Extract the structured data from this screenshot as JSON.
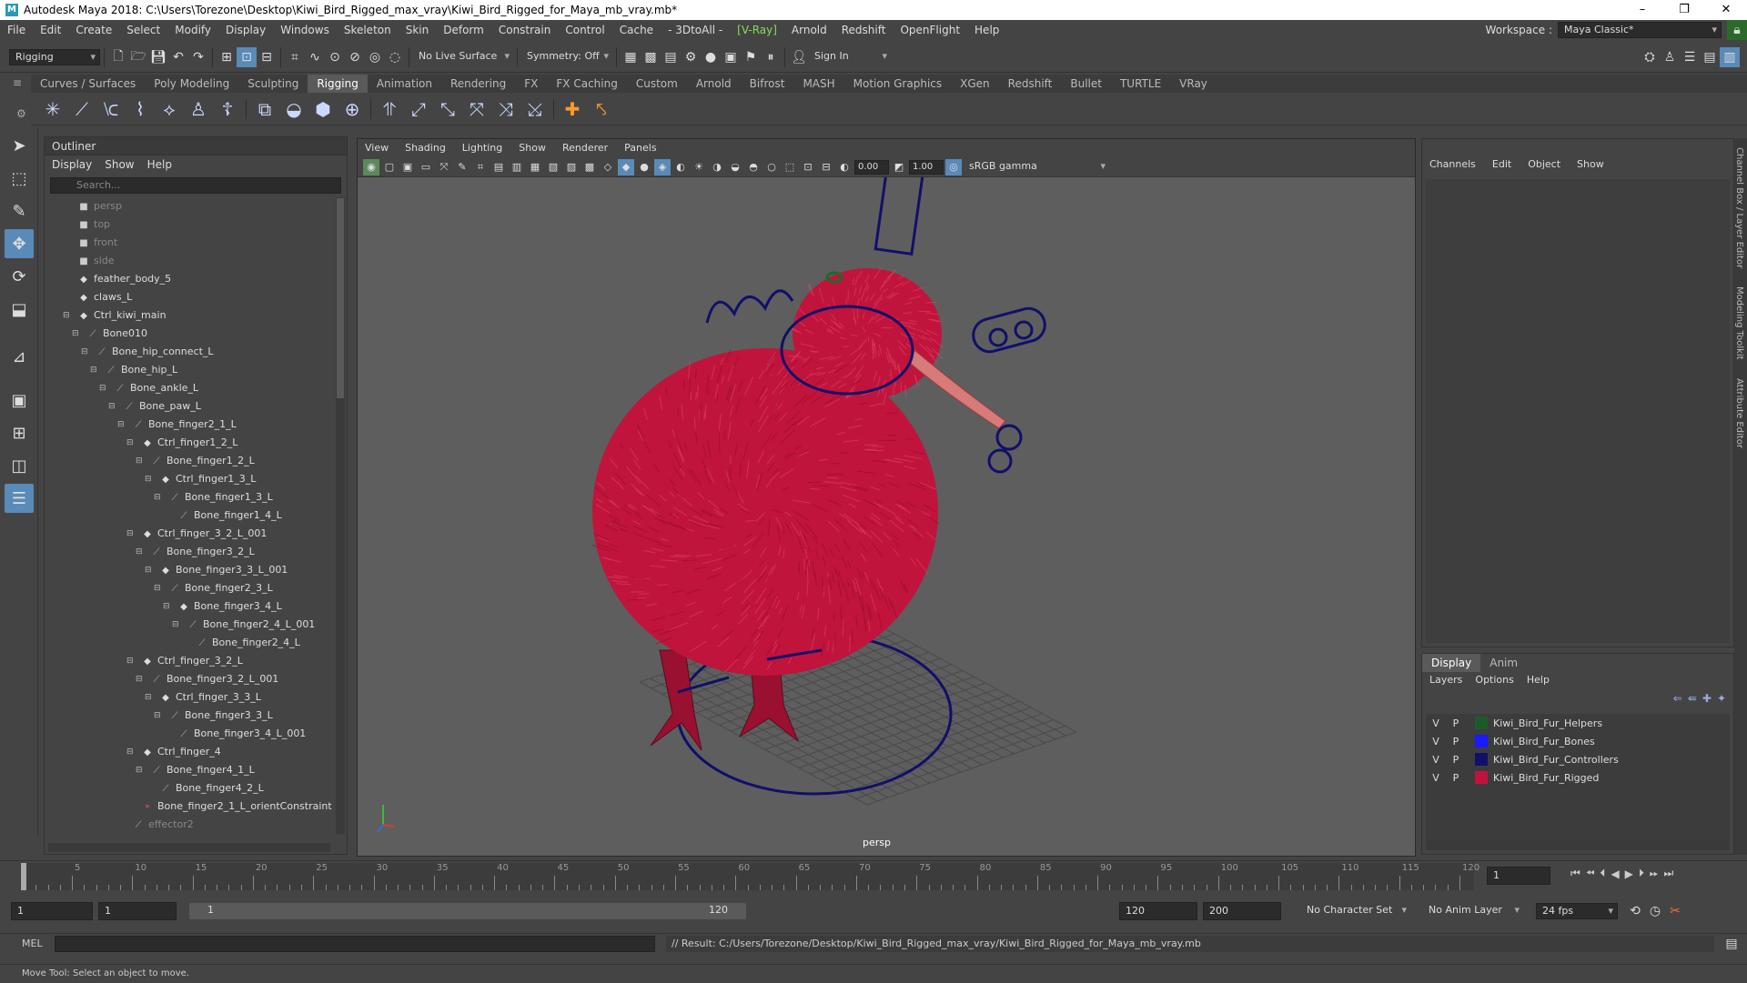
{
  "titlebar": {
    "title": "Autodesk Maya 2018: C:\\Users\\Torezone\\Desktop\\Kiwi_Bird_Rigged_max_vray\\Kiwi_Bird_Rigged_for_Maya_mb_vray.mb*",
    "logo": "M"
  },
  "menus": [
    "File",
    "Edit",
    "Create",
    "Select",
    "Modify",
    "Display",
    "Windows",
    "Skeleton",
    "Skin",
    "Deform",
    "Constrain",
    "Control",
    "Cache",
    "- 3DtoAll -",
    "[V-Ray]",
    "Arnold",
    "Redshift",
    "OpenFlight",
    "Help"
  ],
  "workspace": {
    "label": "Workspace :",
    "value": "Maya Classic*"
  },
  "statusline": {
    "mode": "Rigging",
    "live_surface": "No Live Surface",
    "symmetry": "Symmetry: Off",
    "signin": "Sign In"
  },
  "shelf_tabs": [
    "Curves / Surfaces",
    "Poly Modeling",
    "Sculpting",
    "Rigging",
    "Animation",
    "Rendering",
    "FX",
    "FX Caching",
    "Custom",
    "Arnold",
    "Bifrost",
    "MASH",
    "Motion Graphics",
    "XGen",
    "Redshift",
    "Bullet",
    "TURTLE",
    "VRay"
  ],
  "shelf_active": "Rigging",
  "outliner": {
    "title": "Outliner",
    "menu": [
      "Display",
      "Show",
      "Help"
    ],
    "search_placeholder": "Search...",
    "items": [
      {
        "label": "persp",
        "depth": 0,
        "icon": "camera",
        "dim": true
      },
      {
        "label": "top",
        "depth": 0,
        "icon": "camera",
        "dim": true
      },
      {
        "label": "front",
        "depth": 0,
        "icon": "camera",
        "dim": true
      },
      {
        "label": "side",
        "depth": 0,
        "icon": "camera",
        "dim": true
      },
      {
        "label": "feather_body_5",
        "depth": 0,
        "icon": "group"
      },
      {
        "label": "claws_L",
        "depth": 0,
        "icon": "group"
      },
      {
        "label": "Ctrl_kiwi_main",
        "depth": 0,
        "icon": "group",
        "exp": true
      },
      {
        "label": "Bone010",
        "depth": 1,
        "icon": "joint",
        "exp": true
      },
      {
        "label": "Bone_hip_connect_L",
        "depth": 2,
        "icon": "joint",
        "exp": true
      },
      {
        "label": "Bone_hip_L",
        "depth": 3,
        "icon": "joint",
        "exp": true
      },
      {
        "label": "Bone_ankle_L",
        "depth": 4,
        "icon": "joint",
        "exp": true
      },
      {
        "label": "Bone_paw_L",
        "depth": 5,
        "icon": "joint",
        "exp": true
      },
      {
        "label": "Bone_finger2_1_L",
        "depth": 6,
        "icon": "joint",
        "exp": true
      },
      {
        "label": "Ctrl_finger1_2_L",
        "depth": 7,
        "icon": "group",
        "exp": true
      },
      {
        "label": "Bone_finger1_2_L",
        "depth": 8,
        "icon": "joint",
        "exp": true
      },
      {
        "label": "Ctrl_finger1_3_L",
        "depth": 9,
        "icon": "group",
        "exp": true
      },
      {
        "label": "Bone_finger1_3_L",
        "depth": 10,
        "icon": "joint",
        "exp": true
      },
      {
        "label": "Bone_finger1_4_L",
        "depth": 11,
        "icon": "joint"
      },
      {
        "label": "Ctrl_finger_3_2_L_001",
        "depth": 7,
        "icon": "group",
        "exp": true
      },
      {
        "label": "Bone_finger3_2_L",
        "depth": 8,
        "icon": "joint",
        "exp": true
      },
      {
        "label": "Bone_finger3_3_L_001",
        "depth": 9,
        "icon": "group",
        "exp": true
      },
      {
        "label": "Bone_finger2_3_L",
        "depth": 10,
        "icon": "joint",
        "exp": true
      },
      {
        "label": "Bone_finger3_4_L",
        "depth": 11,
        "icon": "group",
        "exp": true
      },
      {
        "label": "Bone_finger2_4_L_001",
        "depth": 12,
        "icon": "joint",
        "exp": true
      },
      {
        "label": "Bone_finger2_4_L",
        "depth": 13,
        "icon": "joint"
      },
      {
        "label": "Ctrl_finger_3_2_L",
        "depth": 7,
        "icon": "group",
        "exp": true
      },
      {
        "label": "Bone_finger3_2_L_001",
        "depth": 8,
        "icon": "joint",
        "exp": true
      },
      {
        "label": "Ctrl_finger_3_3_L",
        "depth": 9,
        "icon": "group",
        "exp": true
      },
      {
        "label": "Bone_finger3_3_L",
        "depth": 10,
        "icon": "joint",
        "exp": true
      },
      {
        "label": "Bone_finger3_4_L_001",
        "depth": 11,
        "icon": "joint"
      },
      {
        "label": "Ctrl_finger_4",
        "depth": 7,
        "icon": "group",
        "exp": true
      },
      {
        "label": "Bone_finger4_1_L",
        "depth": 8,
        "icon": "joint",
        "exp": true
      },
      {
        "label": "Bone_finger4_2_L",
        "depth": 9,
        "icon": "joint"
      },
      {
        "label": "Bone_finger2_1_L_orientConstraint",
        "depth": 7,
        "icon": "constraint"
      },
      {
        "label": "effector2",
        "depth": 6,
        "icon": "joint",
        "dim": true
      }
    ]
  },
  "viewport": {
    "menu": [
      "View",
      "Shading",
      "Lighting",
      "Show",
      "Renderer",
      "Panels"
    ],
    "exposure": "0.00",
    "gamma": "1.00",
    "colorspace": "sRGB gamma",
    "camera": "persp"
  },
  "channelbox": {
    "menu": [
      "Channels",
      "Edit",
      "Object",
      "Show"
    ]
  },
  "layers": {
    "tabs": [
      "Display",
      "Anim"
    ],
    "active_tab": "Display",
    "menu": [
      "Layers",
      "Options",
      "Help"
    ],
    "rows": [
      {
        "v": "V",
        "p": "P",
        "name": "Kiwi_Bird_Fur_Helpers",
        "color": "#1d5a2a"
      },
      {
        "v": "V",
        "p": "P",
        "name": "Kiwi_Bird_Fur_Bones",
        "color": "#1a1aff"
      },
      {
        "v": "V",
        "p": "P",
        "name": "Kiwi_Bird_Fur_Controllers",
        "color": "#10106a"
      },
      {
        "v": "V",
        "p": "P",
        "name": "Kiwi_Bird_Fur_Rigged",
        "color": "#c0143c"
      }
    ]
  },
  "sidetabs": [
    "Channel Box / Layer Editor",
    "Modeling Toolkit",
    "Attribute Editor"
  ],
  "timeline": {
    "labels": [
      "5",
      "10",
      "15",
      "20",
      "25",
      "30",
      "35",
      "40",
      "45",
      "50",
      "55",
      "60",
      "65",
      "70",
      "75",
      "80",
      "85",
      "90",
      "95",
      "100",
      "105",
      "110",
      "115",
      "120"
    ],
    "current_frame": "1",
    "start": 1,
    "end": 120
  },
  "range": {
    "start": "1",
    "playstart": "1",
    "slider_start": "1",
    "slider_end": "120",
    "playend": "120",
    "end": "200",
    "character_set": "No Character Set",
    "anim_layer": "No Anim Layer",
    "fps": "24 fps"
  },
  "cmdline": {
    "lang": "MEL",
    "result": "// Result: C:/Users/Torezone/Desktop/Kiwi_Bird_Rigged_max_vray/Kiwi_Bird_Rigged_for_Maya_mb_vray.mb"
  },
  "helpline": "Move Tool: Select an object to move.",
  "colors": {
    "fur": "#c0143c",
    "controllers": "#10106a",
    "accent": "#5a8ab8"
  }
}
